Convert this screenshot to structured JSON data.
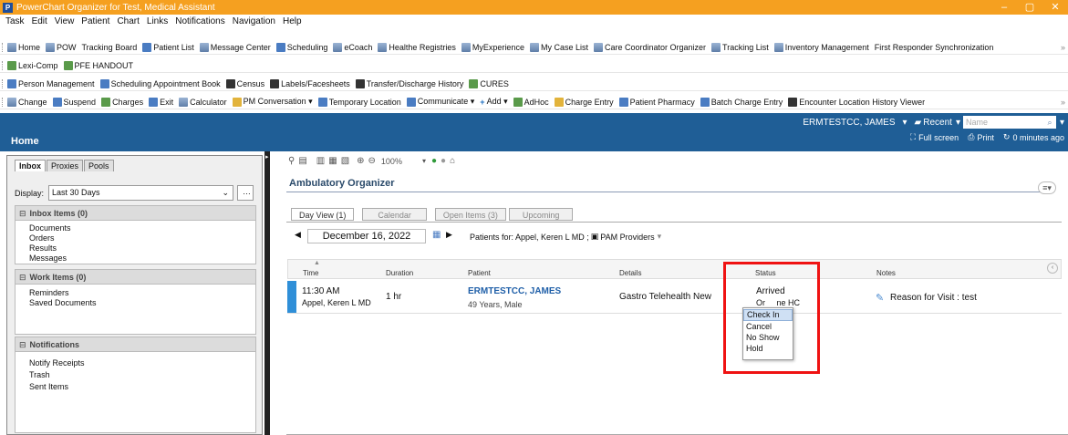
{
  "window": {
    "title": "PowerChart Organizer for Test, Medical Assistant",
    "minimize": "–",
    "maximize": "▢",
    "close": "✕"
  },
  "menu": [
    "Task",
    "Edit",
    "View",
    "Patient",
    "Chart",
    "Links",
    "Notifications",
    "Navigation",
    "Help"
  ],
  "toolbar1": [
    "Home",
    "POW",
    "Tracking Board",
    "Patient List",
    "Message Center",
    "Scheduling",
    "eCoach",
    "Healthe Registries",
    "MyExperience",
    "My Case List",
    "Care Coordinator Organizer",
    "Tracking List",
    "Inventory Management",
    "First Responder Synchronization"
  ],
  "toolbar2": [
    "Lexi-Comp",
    "PFE HANDOUT"
  ],
  "toolbar3": [
    "Person Management",
    "Scheduling Appointment Book",
    "Census",
    "Labels/Facesheets",
    "Transfer/Discharge History",
    "CURES"
  ],
  "toolbar4": [
    "Change",
    "Suspend",
    "Charges",
    "Exit",
    "Calculator",
    "PM Conversation ▾",
    "Temporary Location",
    "Communicate ▾",
    "Add ▾",
    "AdHoc",
    "Charge Entry",
    "Patient Pharmacy",
    "Batch Charge Entry",
    "Encounter Location History Viewer"
  ],
  "userbar": {
    "user": "ERMTESTCC, JAMES",
    "recent": "Recent",
    "search_placeholder": "Name"
  },
  "homebar": {
    "title": "Home",
    "fullscreen": "Full screen",
    "print": "Print",
    "refresh": "0 minutes ago"
  },
  "inbox": {
    "tabs": [
      "Inbox",
      "Proxies",
      "Pools"
    ],
    "display_label": "Display:",
    "display_value": "Last 30 Days",
    "sections": [
      {
        "title": "Inbox Items (0)",
        "items": [
          "Documents",
          "Orders",
          "Results",
          "Messages"
        ]
      },
      {
        "title": "Work Items (0)",
        "items": [
          "Reminders",
          "Saved Documents"
        ]
      },
      {
        "title": "Notifications",
        "items": [
          "Notify Receipts",
          "Trash",
          "Sent Items"
        ]
      }
    ]
  },
  "organizer": {
    "zoom": "100%",
    "title": "Ambulatory Organizer",
    "tabs": [
      "Day View (1)",
      "Calendar",
      "Open Items (3)",
      "Upcoming"
    ],
    "date": "December 16, 2022",
    "patients_for": "Patients for: Appel, Keren L MD ; ",
    "providers": "PAM Providers",
    "columns": [
      "Time",
      "Duration",
      "Patient",
      "Details",
      "Status",
      "Notes"
    ],
    "row": {
      "time": "11:30 AM",
      "provider": "Appel, Keren L MD",
      "duration": "1 hr",
      "patient": "ERMTESTCC, JAMES",
      "age_sex": "49 Years, Male",
      "details": "Gastro Telehealth New",
      "status": "Arrived",
      "status_partial": "Or     ne HC",
      "notes": "Reason for Visit : test"
    },
    "status_menu": [
      "Check In",
      "Cancel",
      "No Show",
      "Hold"
    ]
  },
  "colors": {
    "titlebar": "#f5a020",
    "header": "#1f5e96",
    "highlight": "#ef1212",
    "link": "#1f5fa8"
  }
}
